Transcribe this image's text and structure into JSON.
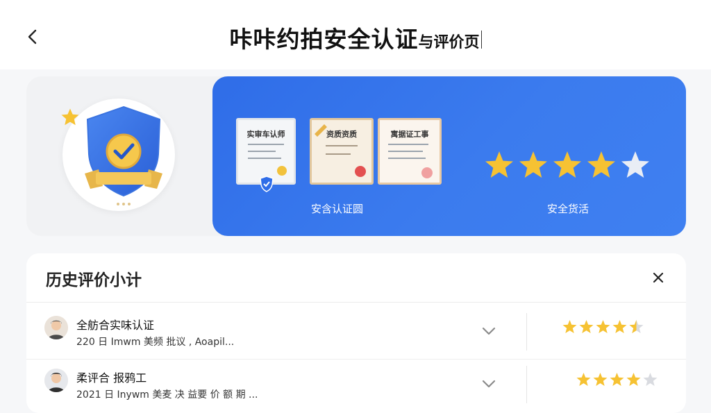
{
  "header": {
    "title_main": "咔咔约拍安全认证",
    "title_suffix": "与评价页",
    "back_icon": "chevron-left-icon"
  },
  "hero": {
    "badge_icon": "shield-check-icon",
    "certificates": [
      {
        "title": "实审车认师"
      },
      {
        "title": "资质资质"
      },
      {
        "title": "寓据证工事"
      }
    ],
    "cert_label": "安含认证圆",
    "rating_label": "安全货活",
    "rating": 4,
    "rating_max": 5,
    "colors": {
      "panel": "#3a78ee",
      "star": "#f6c233",
      "star_empty": "#e9edf5"
    }
  },
  "history": {
    "title": "历史评价小计",
    "close_icon": "close-icon",
    "items": [
      {
        "name": "全舫合实味认证",
        "meta": "220 日 Imwm 美频 批议 , Aoapil...",
        "rating": 4.5
      },
      {
        "name": "柔评合 报鸦工",
        "meta": "2021 日 Inywm 美麦 决 益要 价 额 期 ...",
        "rating": 4
      }
    ]
  }
}
